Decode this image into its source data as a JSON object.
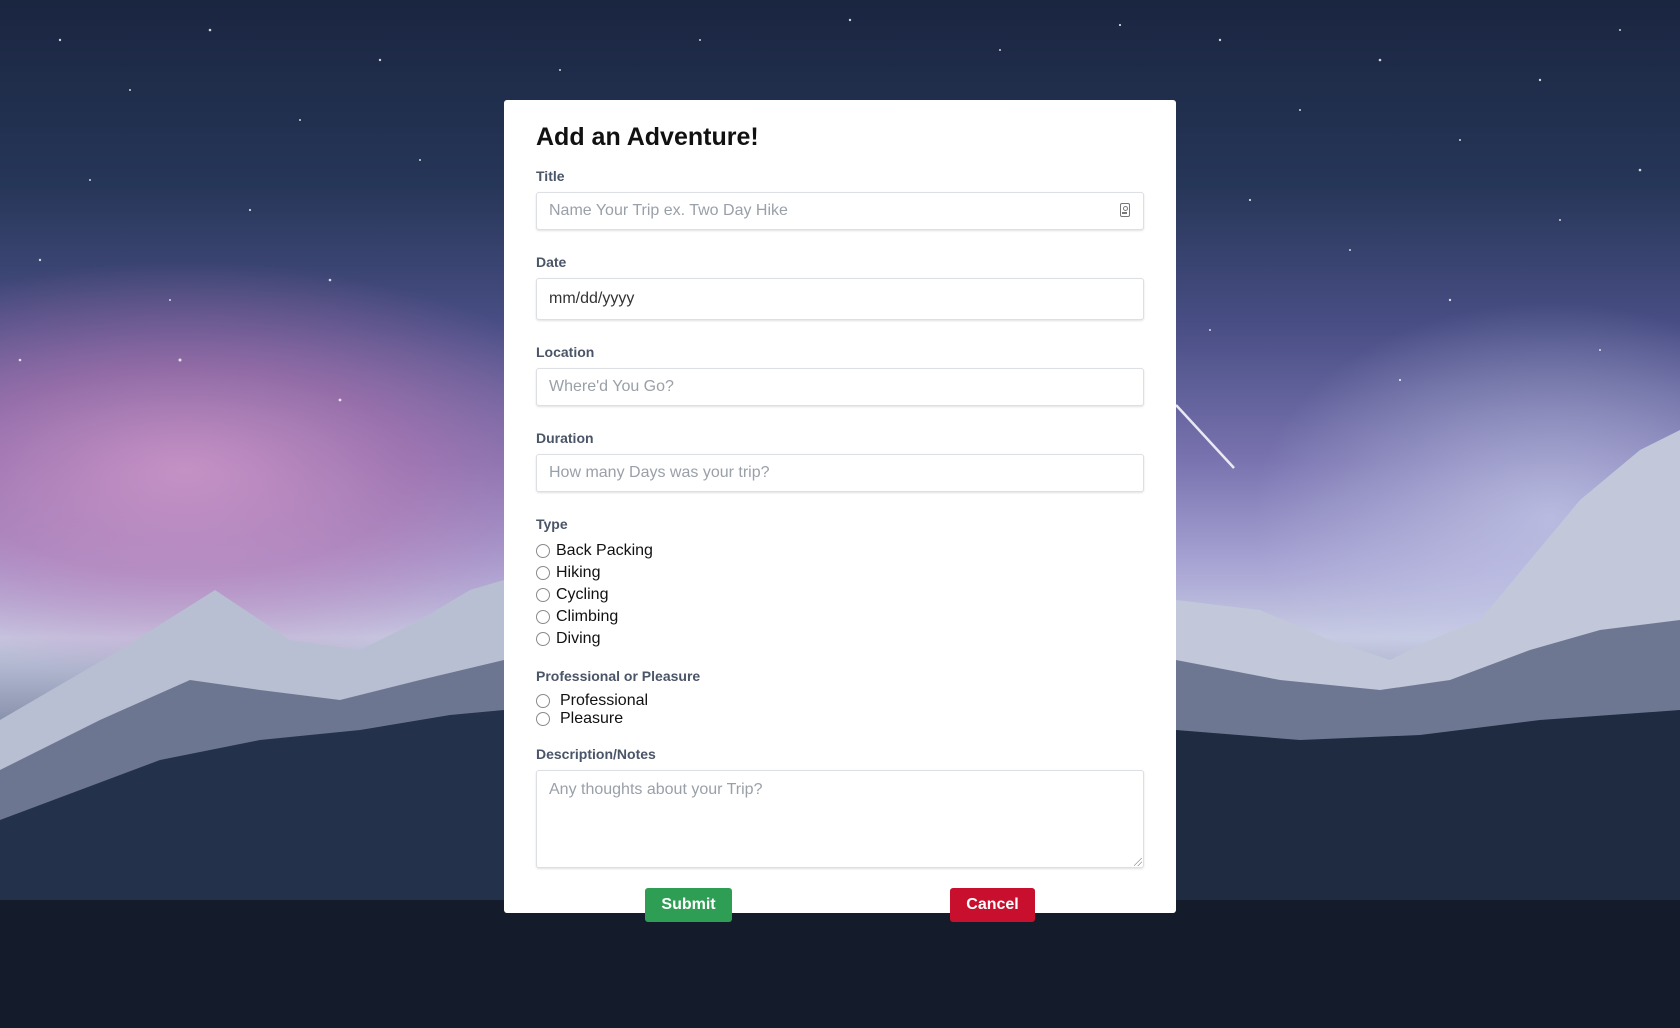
{
  "form": {
    "title": "Add an Adventure!",
    "fields": {
      "title": {
        "label": "Title",
        "placeholder": "Name Your Trip ex. Two Day Hike"
      },
      "date": {
        "label": "Date",
        "placeholder": "mm/dd/yyyy"
      },
      "location": {
        "label": "Location",
        "placeholder": "Where'd You Go?"
      },
      "duration": {
        "label": "Duration",
        "placeholder": "How many Days was your trip?"
      },
      "description": {
        "label": "Description/Notes",
        "placeholder": "Any thoughts about your Trip?"
      }
    },
    "type": {
      "label": "Type",
      "options": [
        "Back Packing",
        "Hiking",
        "Cycling",
        "Climbing",
        "Diving"
      ]
    },
    "purpose": {
      "label": "Professional or Pleasure",
      "options": [
        "Professional",
        "Pleasure"
      ]
    },
    "buttons": {
      "submit": "Submit",
      "cancel": "Cancel"
    }
  },
  "colors": {
    "submit": "#2f9e55",
    "cancel": "#c8102e"
  },
  "icons": {
    "title_field_icon": "contact-card-icon"
  }
}
